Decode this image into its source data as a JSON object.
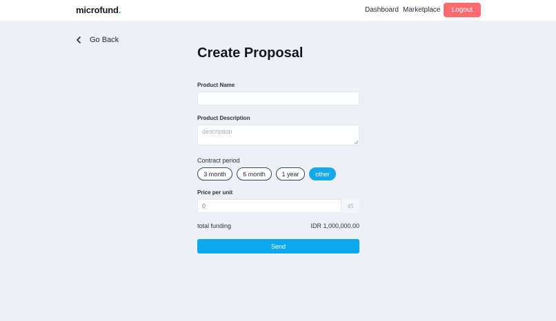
{
  "navbar": {
    "logo_text": "microfund",
    "logo_dot": ".",
    "links": {
      "dashboard": "Dashboard",
      "marketplace": "Marketplace"
    },
    "logout_label": "Logout"
  },
  "back": {
    "label": "Go Back",
    "icon": "chevron-left-icon"
  },
  "form": {
    "title": "Create Proposal",
    "product_name": {
      "label": "Product Name",
      "value": "",
      "placeholder": ""
    },
    "product_description": {
      "label": "Product Description",
      "value": "",
      "placeholder": "description"
    },
    "contract_period": {
      "label": "Contract period",
      "options": [
        {
          "label": "3 month",
          "selected": false
        },
        {
          "label": "6 month",
          "selected": false
        },
        {
          "label": "1 year",
          "selected": false
        },
        {
          "label": "other",
          "selected": true
        }
      ]
    },
    "price_per_unit": {
      "label": "Price per unit",
      "value": "",
      "placeholder": "0",
      "suffix": "45"
    },
    "total_funding": {
      "label": "total funding",
      "value": "IDR 1,000,000.00"
    },
    "send_label": "Send"
  },
  "colors": {
    "background": "#edf1f6",
    "accent": "#14a9ea",
    "logout": "#fd6b6f",
    "text": "#1f2430"
  }
}
